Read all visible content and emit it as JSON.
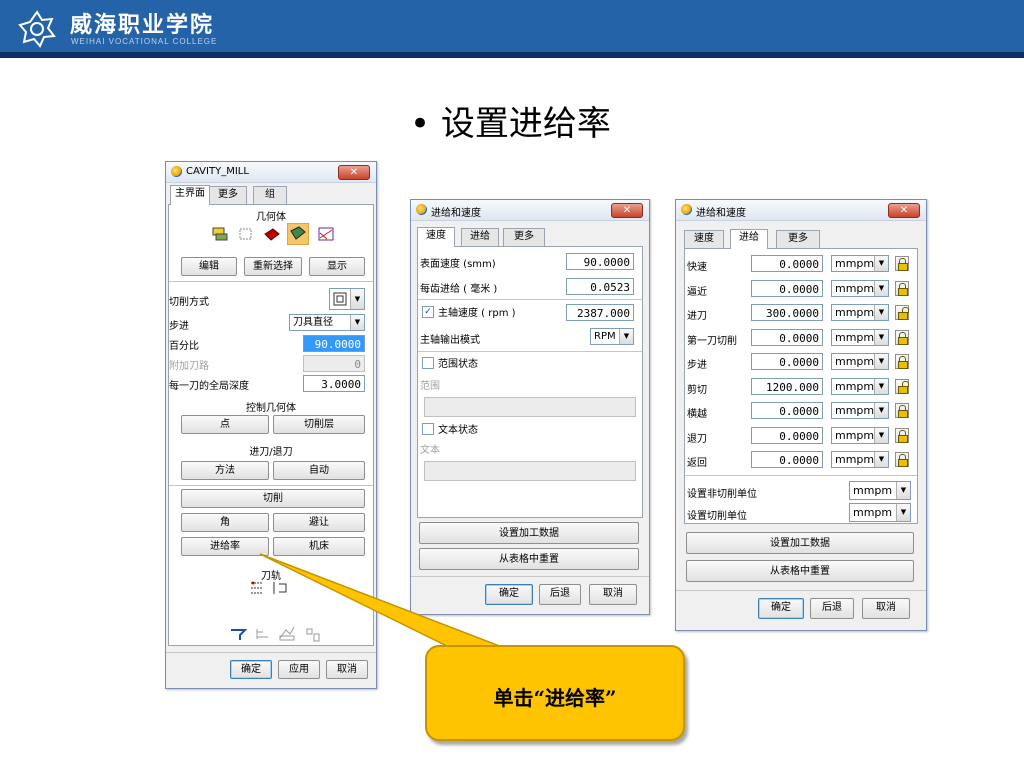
{
  "header": {
    "school_name": "威海职业学院",
    "school_name_en": "WEIHAI VOCATIONAL COLLEGE",
    "emblem_icon": "college-emblem-icon",
    "colors": {
      "bar": "#2563a8",
      "stripe": "#0c2f66"
    }
  },
  "slide": {
    "title": "• 设置进给率"
  },
  "callout": {
    "text": "单击“进给率”",
    "color": "#ffc400"
  },
  "cavity_dialog": {
    "title": "CAVITY_MILL",
    "tabs": [
      "主界面",
      "更多",
      "组"
    ],
    "geometry_group": "几何体",
    "geometry_icons": [
      "geometry-part-icon",
      "geometry-blank-icon",
      "geometry-check-icon",
      "geometry-cut-area-icon",
      "geometry-trim-icon"
    ],
    "buttons_row1": [
      "编辑",
      "重新选择",
      "显示"
    ],
    "cut_pattern_label": "切削方式",
    "stepover_label": "步进",
    "stepover_value": "刀具直径",
    "percent_label": "百分比",
    "percent_value": "90.0000",
    "extra_passes_label": "附加刀路",
    "extra_passes_value": "0",
    "depth_label": "每一刀的全局深度",
    "depth_value": "3.0000",
    "control_geometry_group": "控制几何体",
    "control_buttons": [
      "点",
      "切削层"
    ],
    "engage_group": "进刀/退刀",
    "engage_buttons": [
      "方法",
      "自动"
    ],
    "cutting_button": "切削",
    "corner_button": "角",
    "avoid_button": "避让",
    "feeds_button": "进给率",
    "machine_button": "机床",
    "toolpath_group": "刀轨",
    "footer": [
      "确定",
      "应用",
      "取消"
    ]
  },
  "feed_dialog_1": {
    "title": "进给和速度",
    "tabs": [
      "速度",
      "进给",
      "更多"
    ],
    "surface_speed_label": "表面速度 (smm)",
    "surface_speed_value": "90.0000",
    "feed_per_tooth_label": "每齿进给 ( 毫米 )",
    "feed_per_tooth_value": "0.0523",
    "spindle_label": "主轴速度 ( rpm )",
    "spindle_value": "2387.000",
    "spindle_checked": true,
    "output_mode_label": "主轴输出模式",
    "output_mode_value": "RPM",
    "range_status_label": "范围状态",
    "range_label": "范围",
    "text_status_label": "文本状态",
    "text_label": "文本",
    "set_data_button": "设置加工数据",
    "reset_button": "从表格中重置",
    "footer": [
      "确定",
      "后退",
      "取消"
    ]
  },
  "feed_dialog_2": {
    "title": "进给和速度",
    "tabs": [
      "速度",
      "进给",
      "更多"
    ],
    "rows": [
      {
        "label": "快速",
        "value": "0.0000",
        "unit": "mmpm",
        "lock": "closed"
      },
      {
        "label": "逼近",
        "value": "0.0000",
        "unit": "mmpm",
        "lock": "closed"
      },
      {
        "label": "进刀",
        "value": "300.0000",
        "unit": "mmpm",
        "lock": "open"
      },
      {
        "label": "第一刀切削",
        "value": "0.0000",
        "unit": "mmpm",
        "lock": "closed"
      },
      {
        "label": "步进",
        "value": "0.0000",
        "unit": "mmpm",
        "lock": "closed"
      },
      {
        "label": "剪切",
        "value": "1200.000",
        "unit": "mmpm",
        "lock": "open"
      },
      {
        "label": "横越",
        "value": "0.0000",
        "unit": "mmpm",
        "lock": "closed"
      },
      {
        "label": "退刀",
        "value": "0.0000",
        "unit": "mmpm",
        "lock": "closed"
      },
      {
        "label": "返回",
        "value": "0.0000",
        "unit": "mmpm",
        "lock": "closed"
      }
    ],
    "noncut_unit_label": "设置非切削单位",
    "noncut_unit_value": "mmpm",
    "cut_unit_label": "设置切削单位",
    "cut_unit_value": "mmpm",
    "set_data_button": "设置加工数据",
    "reset_button": "从表格中重置",
    "footer": [
      "确定",
      "后退",
      "取消"
    ]
  }
}
